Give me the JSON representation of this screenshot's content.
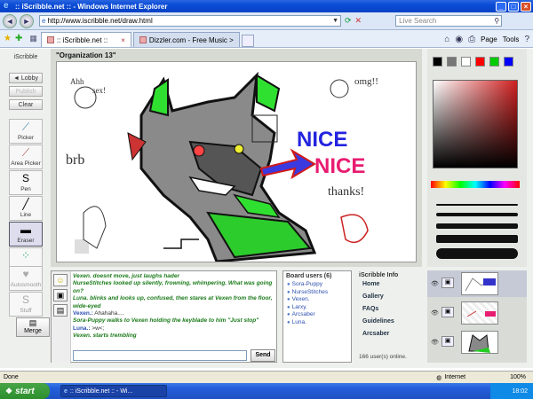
{
  "window": {
    "title": ":: iScribble.net :: - Windows Internet Explorer"
  },
  "address": {
    "url": "http://www.iscribble.net/draw.html",
    "search_placeholder": "Live Search"
  },
  "tabs": [
    {
      "label": ":: iScribble.net ::"
    },
    {
      "label": "Dizzler.com - Free Music > Ar..."
    }
  ],
  "commandbar": {
    "page_label": "Page",
    "tools_label": "Tools"
  },
  "left_panel": {
    "title": "iScribble",
    "lobby": "◄ Lobby",
    "publish": "Publish",
    "clear": "Clear",
    "tools": [
      "Picker",
      "Area Picker",
      "Pen",
      "Line",
      "Eraser",
      "",
      "Autosmooth",
      "Stuff"
    ],
    "merge": "Merge"
  },
  "canvas": {
    "title": "\"Organization 13\"",
    "text_marks": [
      "Ahh",
      "sex!",
      "omg!!",
      "brb",
      "NICE",
      "NICE",
      "thanks!"
    ]
  },
  "colors": {
    "swatches": [
      "#000000",
      "#777777",
      "#ffffff",
      "#ff0000",
      "#00cc00",
      "#0000ff"
    ]
  },
  "chat": {
    "messages": [
      {
        "type": "em",
        "text": "Vexen. doesnt move, just laughs hader"
      },
      {
        "type": "em",
        "text": "NurseStitches looked up silently, frowning, whimpering. What was going on?"
      },
      {
        "type": "em",
        "text": "Luna. blinks and looks up, confused, then stares at Vexen from the floor, wide-eyed"
      },
      {
        "type": "nm",
        "who": "Vexen.:",
        "text": "Ahahaha...."
      },
      {
        "type": "em",
        "text": "Sora-Puppy walks to Vexen holding the keyblade to him \"Just stop\""
      },
      {
        "type": "nm",
        "who": "Luna.:",
        "text": ">w<;"
      },
      {
        "type": "em",
        "text": "Vexen. starts trembling"
      }
    ],
    "send_label": "Send"
  },
  "board_users": {
    "title": "Board users (6)",
    "users": [
      "Sora-Puppy",
      "NurseStitches",
      "Vexen.",
      "Larxy.",
      "Arcsaber",
      "Luna."
    ]
  },
  "info": {
    "title": "iScribble Info",
    "links": [
      "Home",
      "Gallery",
      "FAQs",
      "Guidelines",
      "Arcsaber"
    ],
    "online": "166 user(s) online."
  },
  "statusbar": {
    "status": "Done",
    "zone": "Internet",
    "zoom": "100%"
  },
  "taskbar": {
    "start": "start",
    "task": ":: iScribble.net :: - Wi...",
    "clock": "18:02"
  }
}
